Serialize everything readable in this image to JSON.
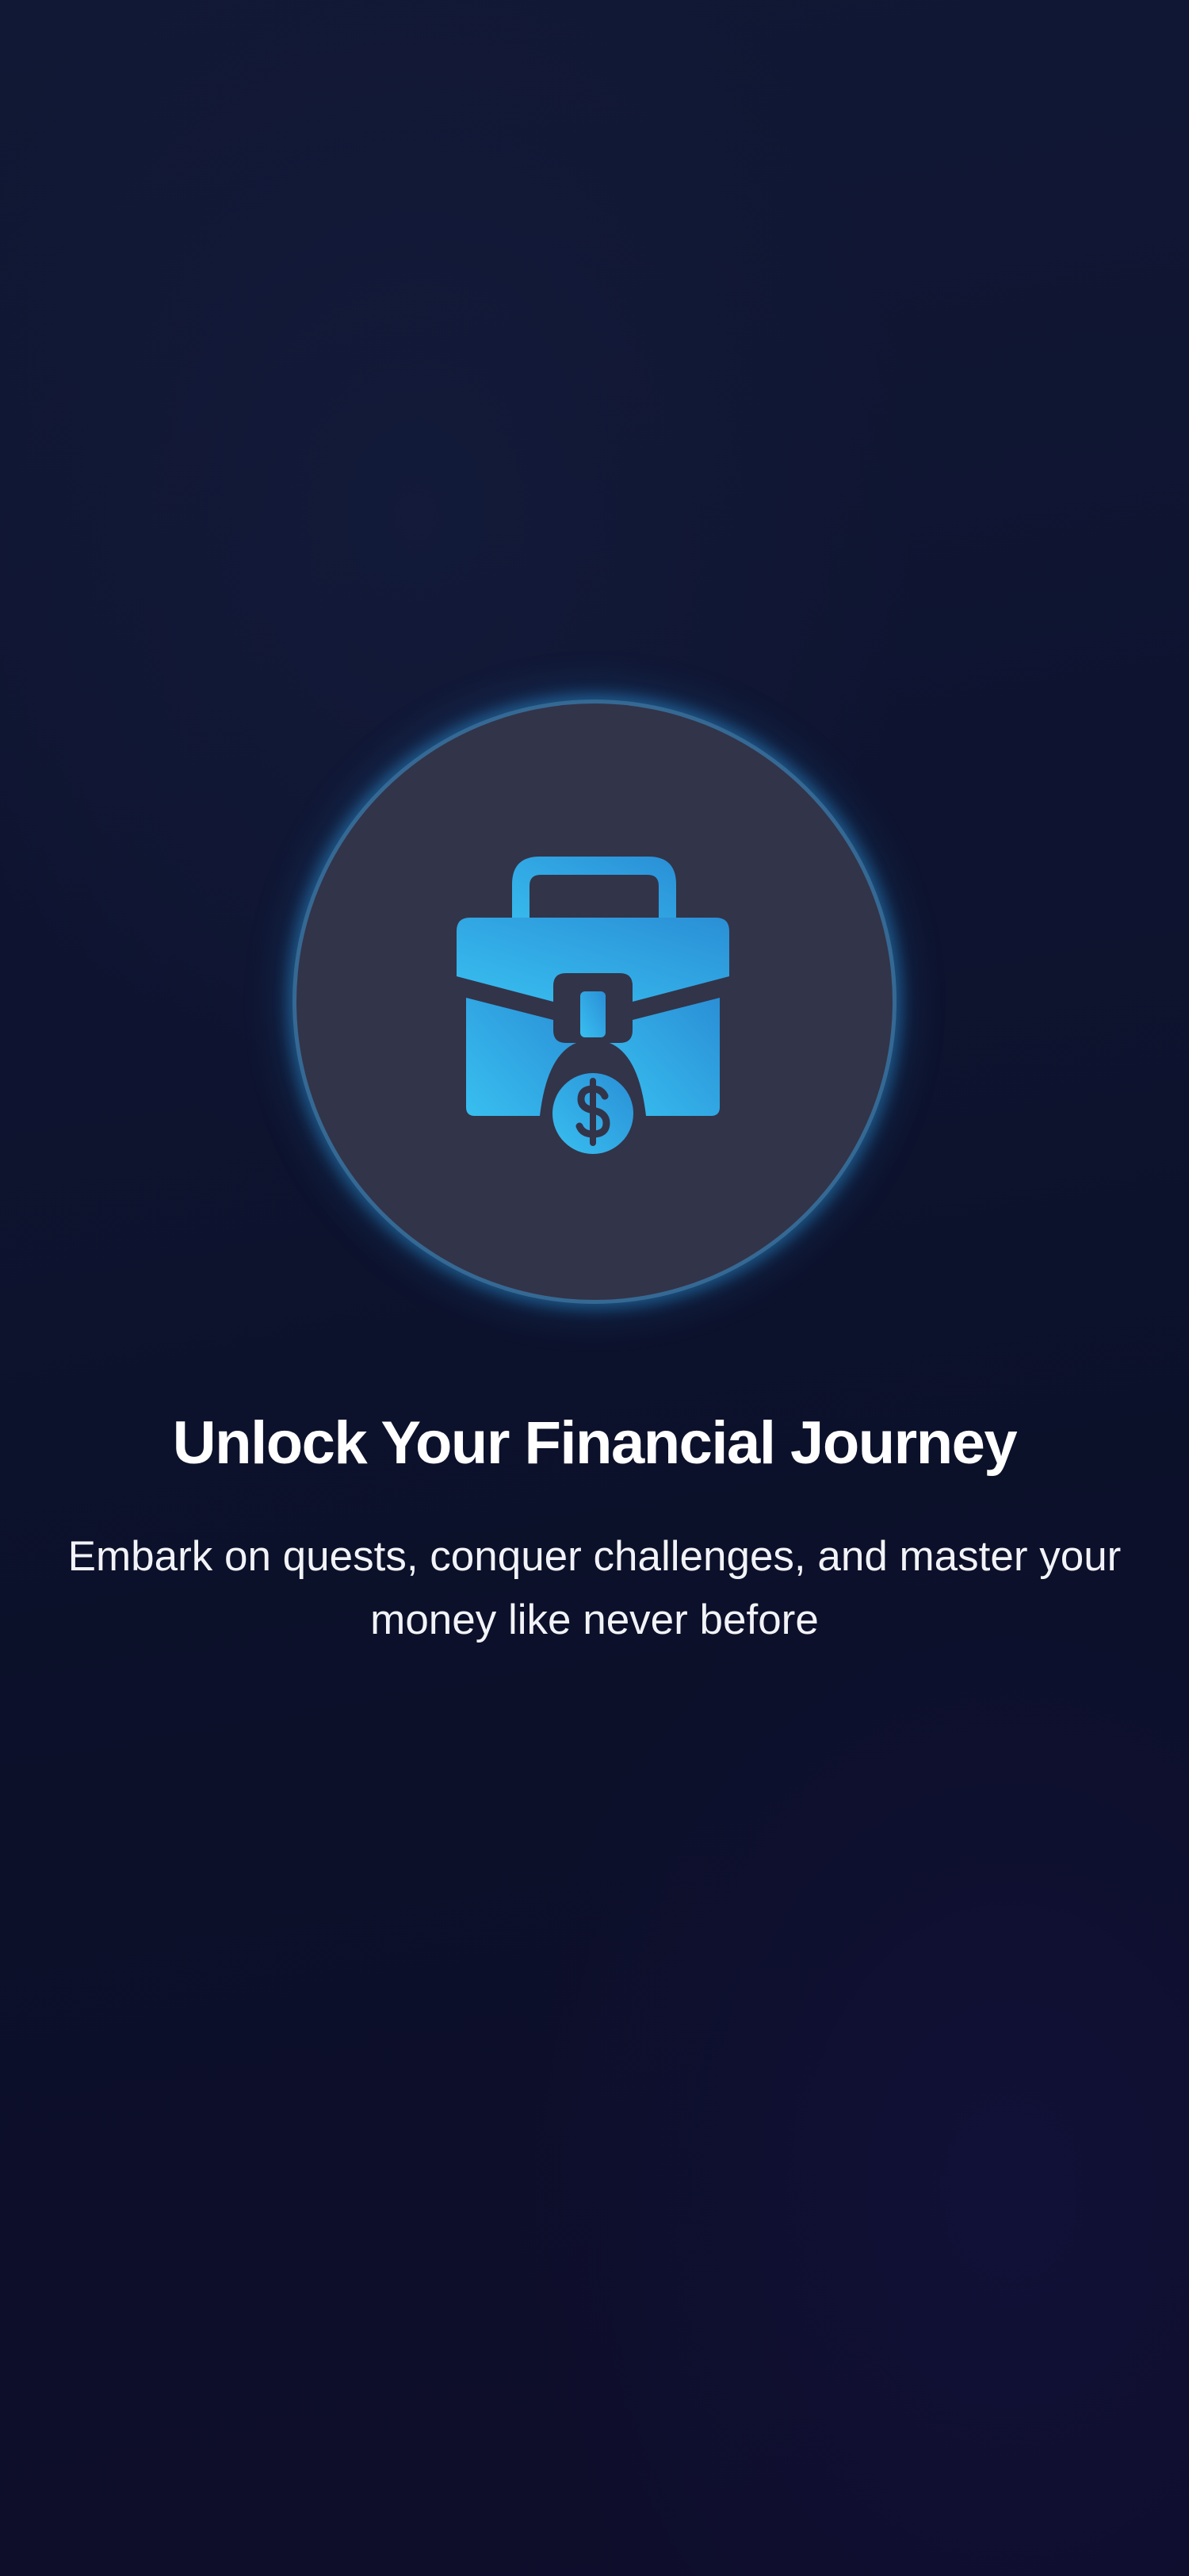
{
  "onboarding": {
    "hero_icon": "briefcase-dollar-icon",
    "title": "Unlock Your Financial Journey",
    "subtitle": "Embark on quests, conquer challenges, and master your money like never before"
  },
  "colors": {
    "background": "#0e1430",
    "circle_fill": "#32344a",
    "glow": "#2d96dc",
    "icon_gradient_start": "#38b8ec",
    "icon_gradient_end": "#2a8fd6",
    "text": "#ffffff"
  }
}
